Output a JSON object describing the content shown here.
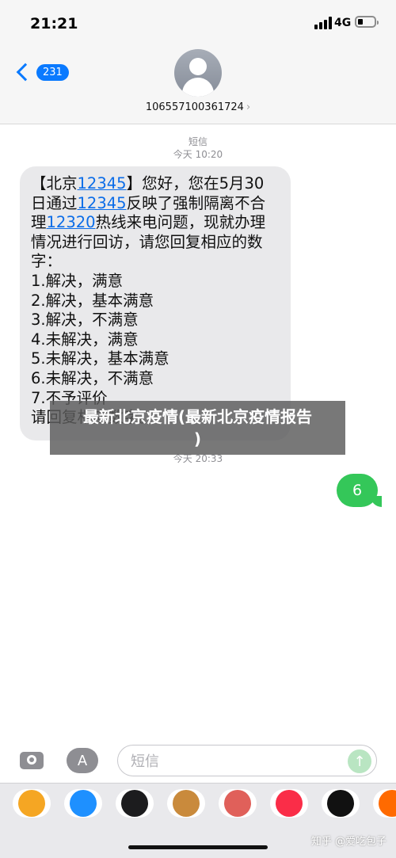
{
  "status_bar": {
    "time": "21:21",
    "network": "4G"
  },
  "header": {
    "back_badge": "231",
    "contact_number": "10655710036172 4",
    "contact_chevron": "›"
  },
  "thread": {
    "meta1_type": "短信",
    "meta1_time": "今天 10:20",
    "incoming_message": {
      "lines": [
        [
          "【北京",
          "12345",
          "】您好，您在5月30"
        ],
        [
          "日通过",
          "12345",
          "反映了强制隔离不合"
        ],
        [
          "理",
          "12320",
          "热线来电问题，现就办理"
        ],
        [
          "情况进行回访，请您回复相应的数"
        ],
        [
          "字："
        ],
        [
          "1.解决，满意"
        ],
        [
          "2.解决，基本满意"
        ],
        [
          "3.解决，不满意"
        ],
        [
          "4.未解决，满意"
        ],
        [
          "5.未解决，基本满意"
        ],
        [
          "6.未解决，不满意"
        ],
        [
          "7.不予评价"
        ],
        [
          "请回复相应数字。"
        ]
      ]
    },
    "meta2_time": "今天 20:33",
    "outgoing_message": "6"
  },
  "overlay": {
    "line1": "最新北京疫情(最新北京疫情报告",
    "line2": ")"
  },
  "input_bar": {
    "placeholder": "短信",
    "appstore_glyph": "A",
    "send_glyph": "↑"
  },
  "apps": [
    {
      "name": "photos",
      "color": "#f5a623"
    },
    {
      "name": "app-store",
      "color": "#1e90ff"
    },
    {
      "name": "activity",
      "color": "#1c1c1e"
    },
    {
      "name": "memoji",
      "color": "#c98a3c"
    },
    {
      "name": "animoji",
      "color": "#e0605a"
    },
    {
      "name": "music",
      "color": "#fa2d48"
    },
    {
      "name": "digital-touch",
      "color": "#111111"
    },
    {
      "name": "more-apps",
      "color": "#ff6a00"
    }
  ],
  "watermark": "知乎 @爱吃包子"
}
